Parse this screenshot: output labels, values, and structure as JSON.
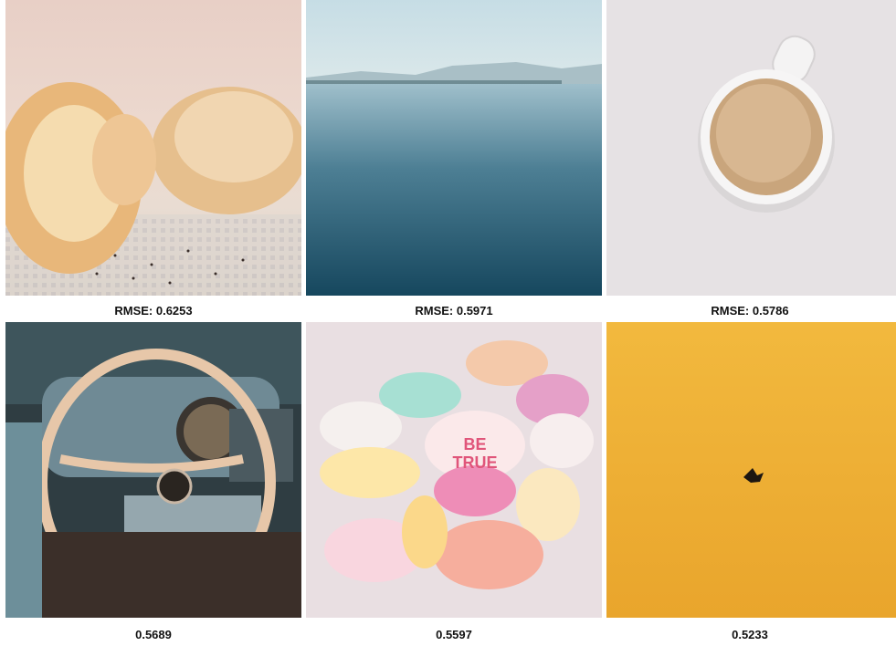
{
  "grid": {
    "items": [
      {
        "subject": "bread",
        "caption": "RMSE: 0.6253"
      },
      {
        "subject": "lake",
        "caption": "RMSE: 0.5971"
      },
      {
        "subject": "coffee-cup",
        "caption": "RMSE: 0.5786"
      },
      {
        "subject": "car-steering-wheel",
        "caption": "0.5689"
      },
      {
        "subject": "candy-hearts",
        "caption": "0.5597",
        "candy_text": [
          "BE",
          "TRUE"
        ]
      },
      {
        "subject": "bird-in-sky",
        "caption": "0.5233"
      }
    ]
  }
}
